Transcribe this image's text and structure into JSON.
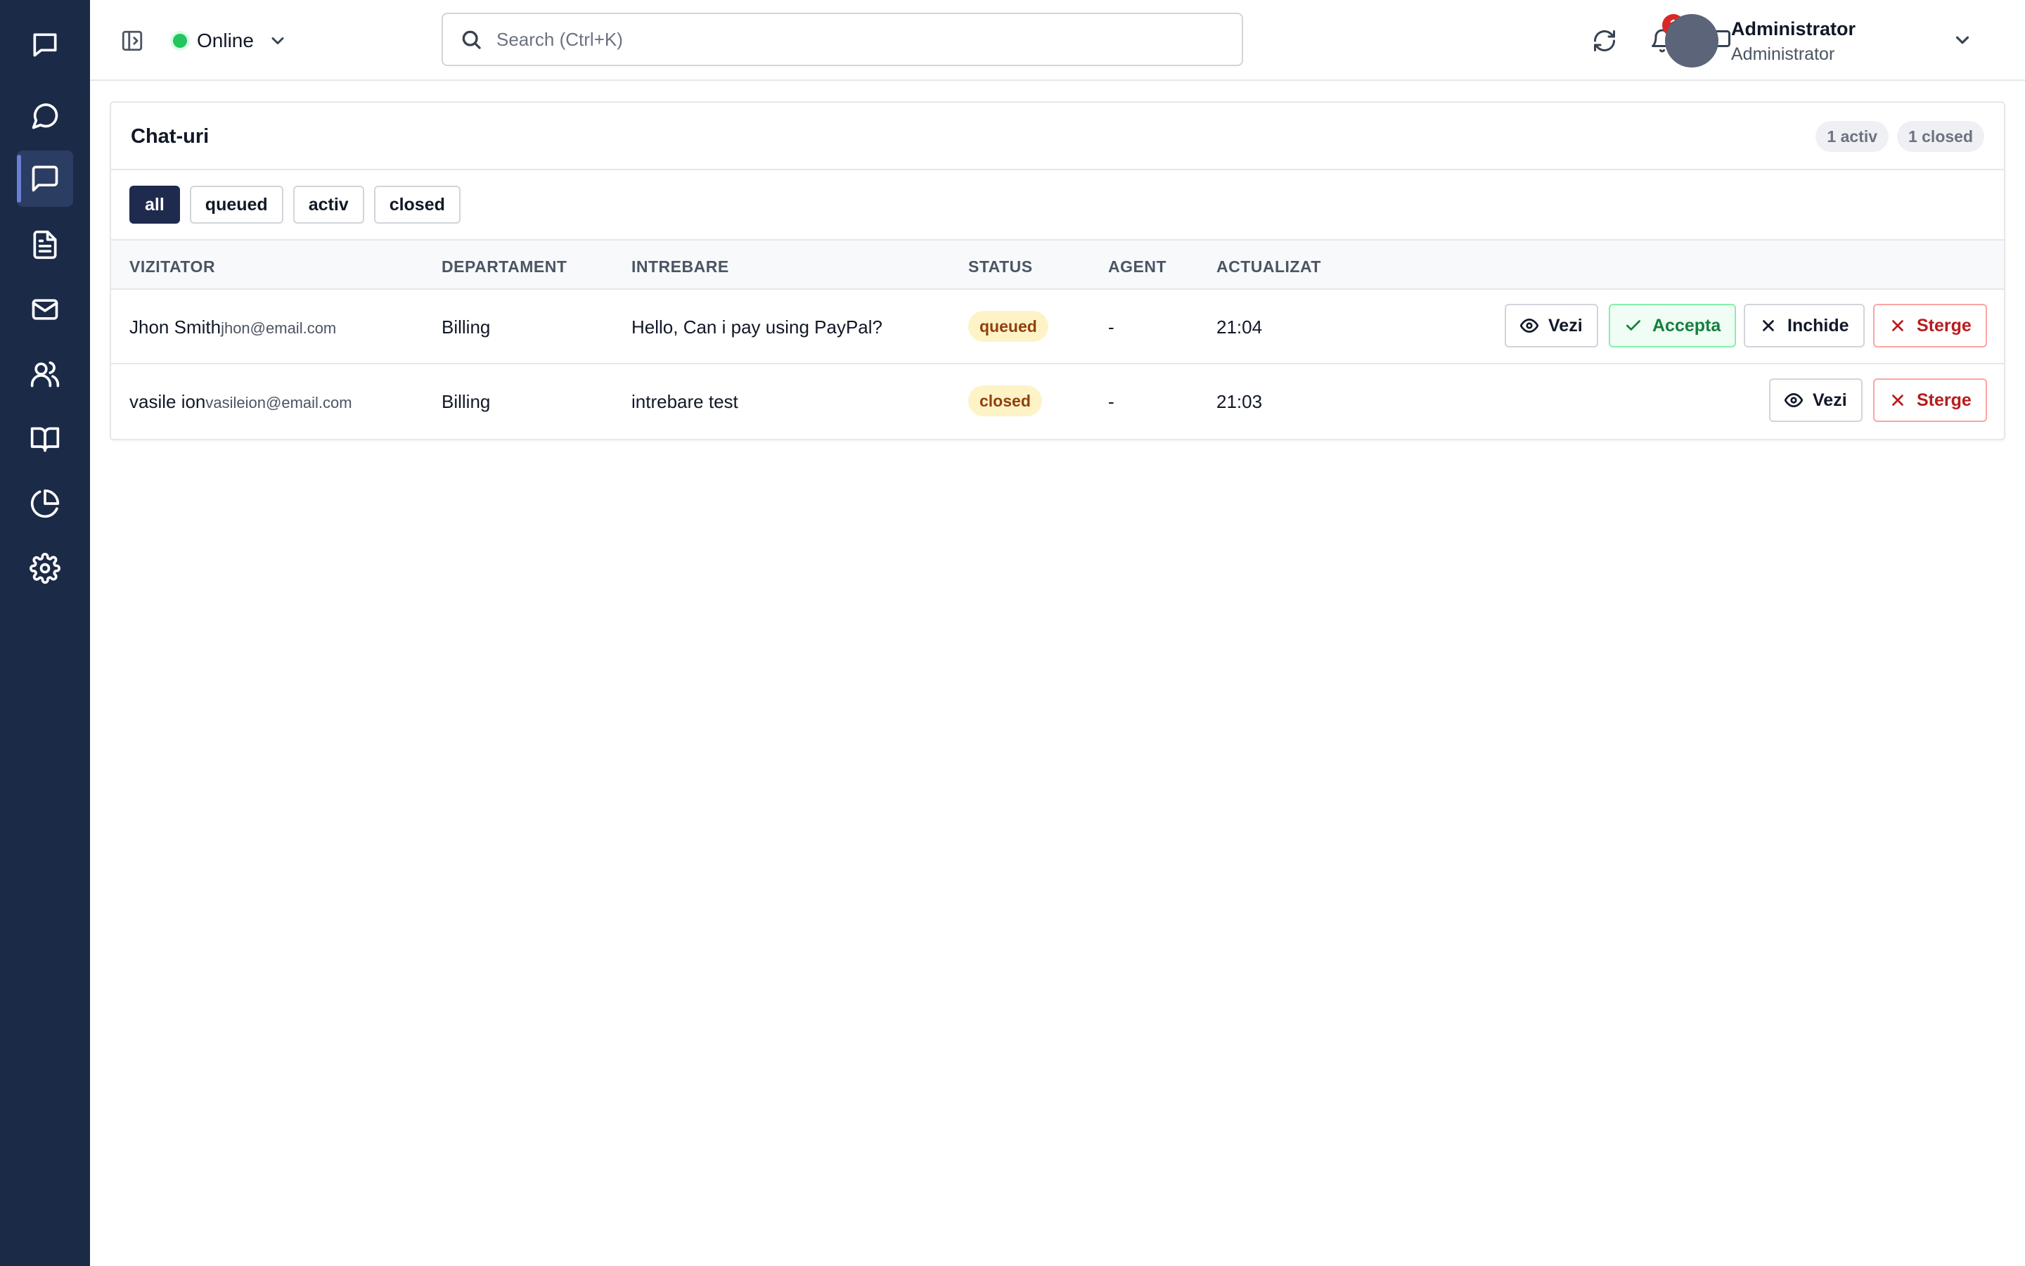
{
  "topbar": {
    "status": "Online",
    "search_placeholder": "Search (Ctrl+K)",
    "notifications_count": "1",
    "user_name": "Administrator",
    "user_role": "Administrator"
  },
  "card": {
    "title": "Chat-uri",
    "counts": {
      "active": "1 activ",
      "closed": "1 closed"
    },
    "filters": [
      "all",
      "queued",
      "activ",
      "closed"
    ],
    "active_filter": "all",
    "columns": [
      "VIZITATOR",
      "DEPARTAMENT",
      "INTREBARE",
      "STATUS",
      "AGENT",
      "ACTUALIZAT"
    ],
    "rows": [
      {
        "name": "Jhon Smith",
        "email": "jhon@email.com",
        "department": "Billing",
        "question": "Hello, Can i pay using PayPal?",
        "status": "queued",
        "agent": "-",
        "updated": "21:04",
        "actions": {
          "view": "Vezi",
          "accept": "Accepta",
          "close": "Inchide",
          "delete": "Sterge"
        }
      },
      {
        "name": "vasile ion",
        "email": "vasileion@email.com",
        "department": "Billing",
        "question": "intrebare test",
        "status": "closed",
        "agent": "-",
        "updated": "21:03",
        "actions": {
          "view": "Vezi",
          "delete": "Sterge"
        }
      }
    ]
  },
  "colors": {
    "sidebar_bg": "#1b2a47",
    "accent": "#1f2a4f",
    "online": "#22c55e",
    "danger": "#b91c1c",
    "success": "#15803d"
  },
  "icons": {
    "sidebar": [
      "chat-square-icon",
      "message-circle-icon",
      "chats-icon",
      "file-text-icon",
      "mail-icon",
      "users-icon",
      "book-icon",
      "pie-chart-icon",
      "settings-icon"
    ],
    "topbar": [
      "sidebar-toggle-icon",
      "chevron-down-icon",
      "search-icon",
      "refresh-icon",
      "bell-icon",
      "message-square-icon"
    ]
  }
}
